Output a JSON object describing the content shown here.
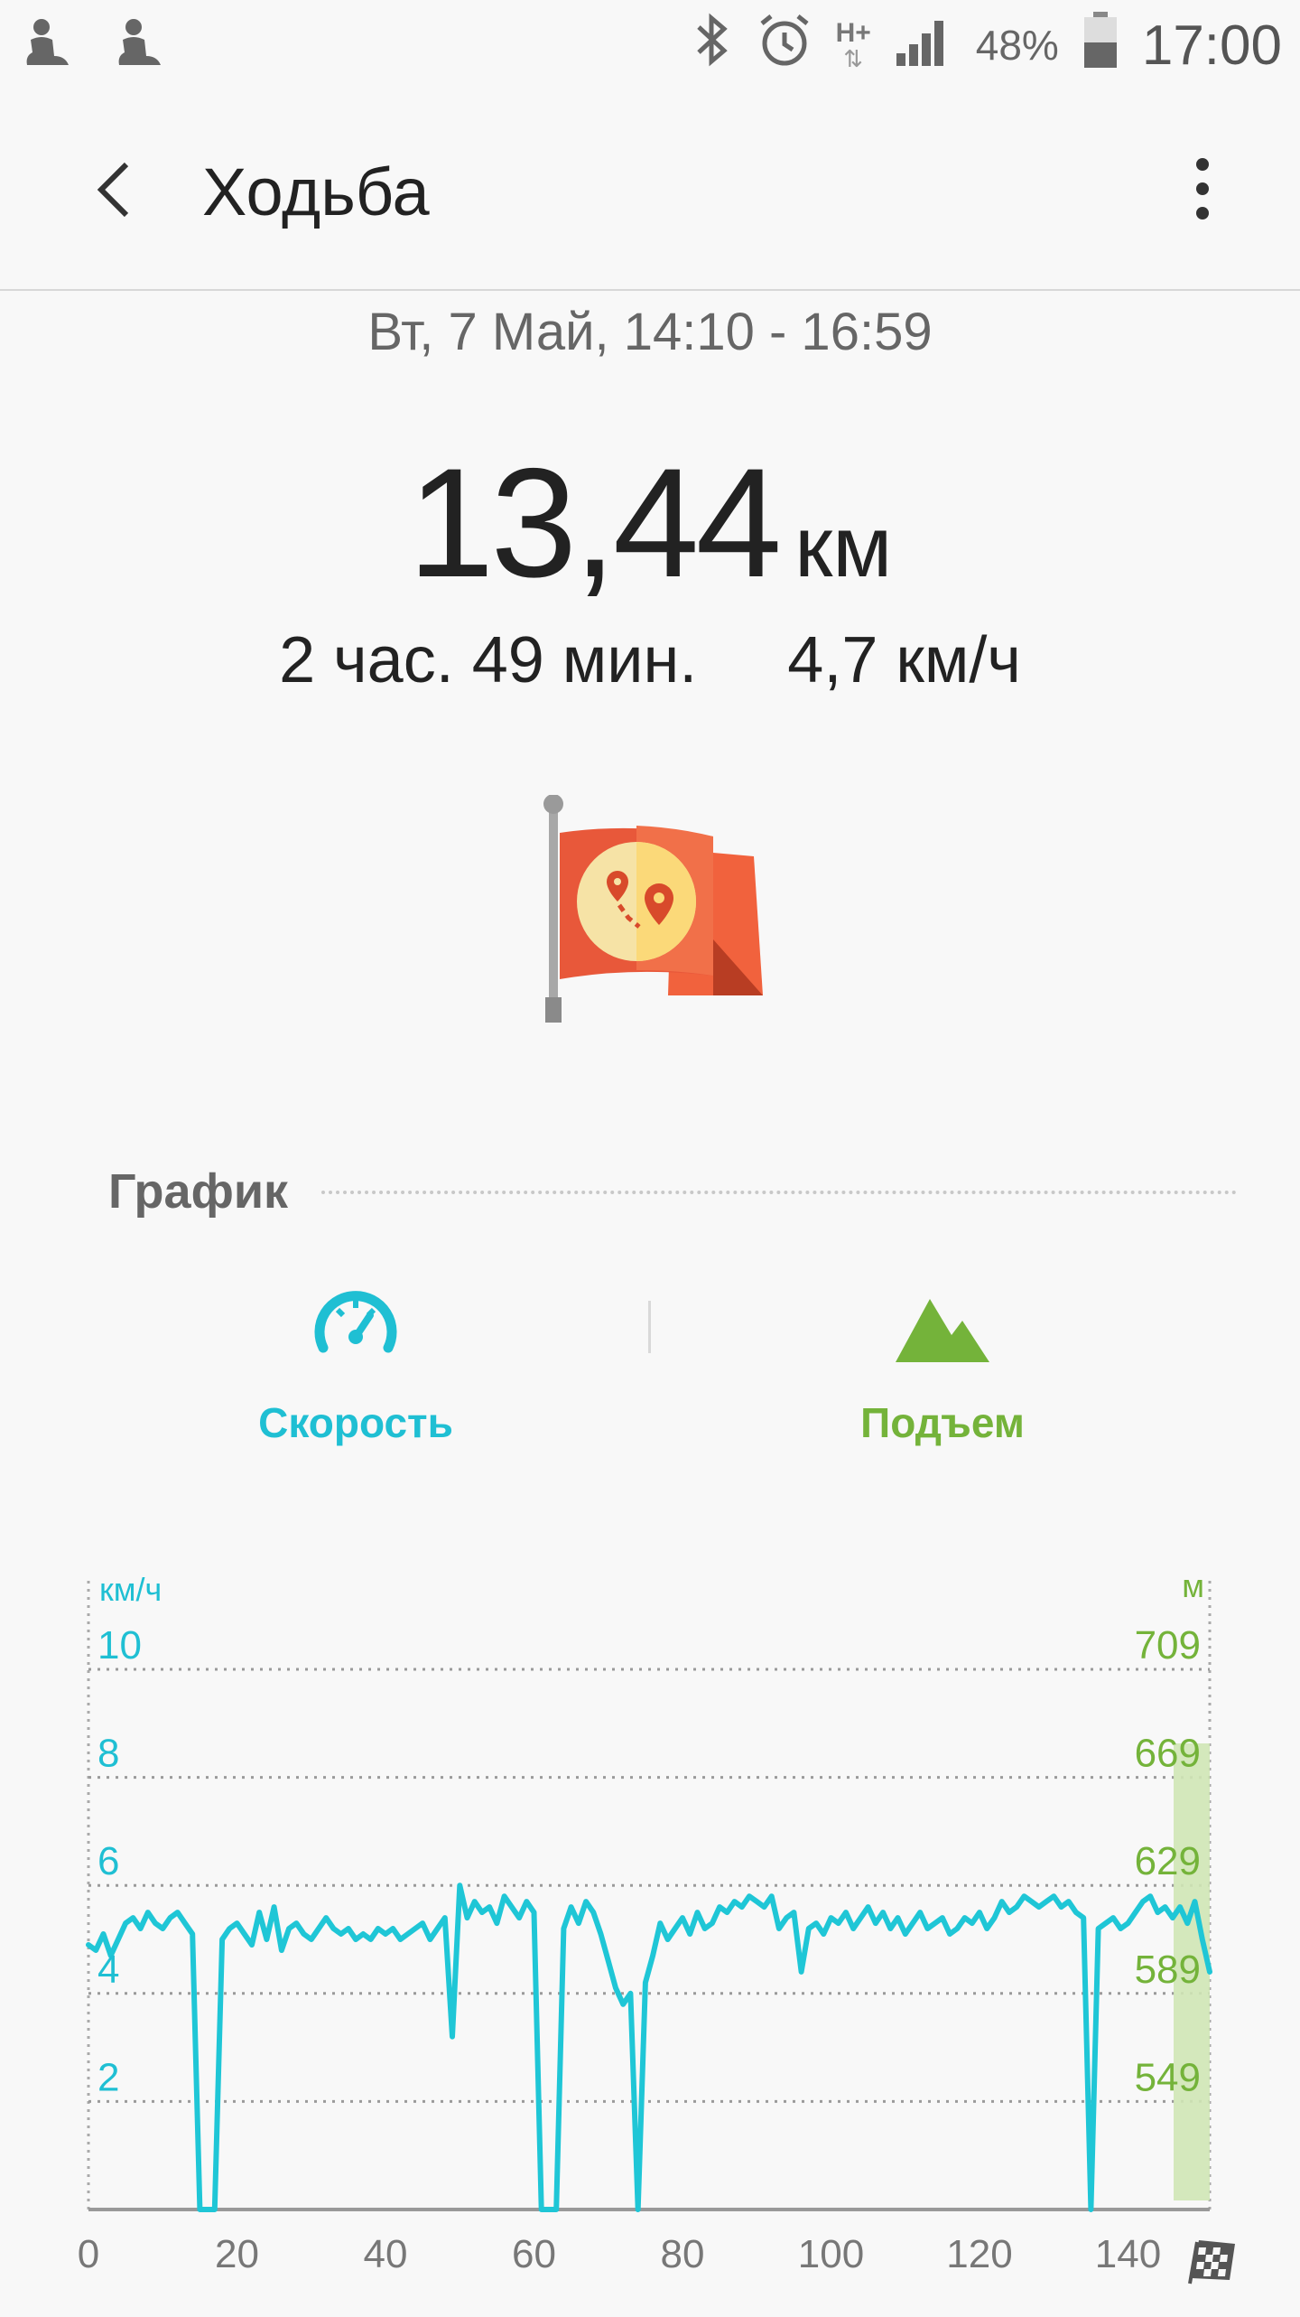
{
  "status_bar": {
    "battery_pct": "48%",
    "time": "17:00",
    "network": "H+",
    "icons": [
      "pedometer-icon",
      "pedometer-icon",
      "bluetooth-icon",
      "alarm-icon",
      "signal-icon",
      "battery-icon"
    ]
  },
  "header": {
    "title": "Ходьба"
  },
  "summary": {
    "date_range": "Вт, 7 Май, 14:10 - 16:59",
    "distance": "13,44",
    "distance_unit": "км",
    "duration": "2 час. 49 мин.",
    "avg_speed": "4,7 км/ч"
  },
  "section": {
    "title": "График"
  },
  "toggles": {
    "speed_label": "Скорость",
    "elevation_label": "Подъем"
  },
  "colors": {
    "speed": "#1fbfd3",
    "elevation": "#74b33a",
    "flag": "#e8583a"
  },
  "chart_data": {
    "type": "line",
    "left_axis_unit": "км/ч",
    "right_axis_unit": "м",
    "y_ticks_left": [
      "10",
      "8",
      "6",
      "4",
      "2"
    ],
    "y_ticks_right": [
      "709",
      "669",
      "629",
      "589",
      "549"
    ],
    "ylim": [
      0,
      10
    ],
    "xlim": [
      0,
      151
    ],
    "x_ticks": [
      "0",
      "20",
      "40",
      "60",
      "80",
      "100",
      "120",
      "140"
    ],
    "grid": true,
    "series": [
      {
        "x": [
          0,
          1,
          2,
          3,
          4,
          5,
          6,
          7,
          8,
          9,
          10,
          11,
          12,
          13,
          14,
          15,
          16,
          17,
          18,
          19,
          20,
          21,
          22,
          23,
          24,
          25,
          26,
          27,
          28,
          29,
          30,
          31,
          32,
          33,
          34,
          35,
          36,
          37,
          38,
          39,
          40,
          41,
          42,
          43,
          44,
          45,
          46,
          47,
          48,
          49,
          50,
          51,
          52,
          53,
          54,
          55,
          56,
          57,
          58,
          59,
          60,
          61,
          62,
          63,
          64,
          65,
          66,
          67,
          68,
          69,
          70,
          71,
          72,
          73,
          74,
          75,
          76,
          77,
          78,
          79,
          80,
          81,
          82,
          83,
          84,
          85,
          86,
          87,
          88,
          89,
          90,
          91,
          92,
          93,
          94,
          95,
          96,
          97,
          98,
          99,
          100,
          101,
          102,
          103,
          104,
          105,
          106,
          107,
          108,
          109,
          110,
          111,
          112,
          113,
          114,
          115,
          116,
          117,
          118,
          119,
          120,
          121,
          122,
          123,
          124,
          125,
          126,
          127,
          128,
          129,
          130,
          131,
          132,
          133,
          134,
          135,
          136,
          137,
          138,
          139,
          140,
          141,
          142,
          143,
          144,
          145,
          146,
          147,
          148,
          149,
          150,
          151
        ],
        "y": [
          4.9,
          4.8,
          5.1,
          4.7,
          5.0,
          5.3,
          5.4,
          5.2,
          5.5,
          5.3,
          5.2,
          5.4,
          5.5,
          5.3,
          5.1,
          0,
          0,
          0,
          5.0,
          5.2,
          5.3,
          5.1,
          4.9,
          5.5,
          5.0,
          5.6,
          4.8,
          5.2,
          5.3,
          5.1,
          5.0,
          5.2,
          5.4,
          5.2,
          5.1,
          5.2,
          5.0,
          5.1,
          5.0,
          5.2,
          5.1,
          5.2,
          5.0,
          5.1,
          5.2,
          5.3,
          5.0,
          5.2,
          5.4,
          3.2,
          6.0,
          5.4,
          5.7,
          5.5,
          5.6,
          5.3,
          5.8,
          5.6,
          5.4,
          5.7,
          5.5,
          0,
          0,
          0,
          5.2,
          5.6,
          5.3,
          5.7,
          5.5,
          5.1,
          4.6,
          4.1,
          3.8,
          4.0,
          0,
          4.2,
          4.7,
          5.3,
          5.0,
          5.2,
          5.4,
          5.1,
          5.5,
          5.2,
          5.3,
          5.6,
          5.5,
          5.7,
          5.6,
          5.8,
          5.7,
          5.6,
          5.8,
          5.2,
          5.4,
          5.5,
          4.4,
          5.2,
          5.3,
          5.1,
          5.4,
          5.3,
          5.5,
          5.2,
          5.4,
          5.6,
          5.3,
          5.5,
          5.2,
          5.4,
          5.1,
          5.3,
          5.5,
          5.2,
          5.3,
          5.4,
          5.1,
          5.2,
          5.4,
          5.3,
          5.5,
          5.2,
          5.4,
          5.7,
          5.5,
          5.6,
          5.8,
          5.7,
          5.6,
          5.7,
          5.8,
          5.6,
          5.7,
          5.5,
          5.4,
          0,
          5.2,
          5.3,
          5.4,
          5.2,
          5.3,
          5.5,
          5.7,
          5.8,
          5.5,
          5.6,
          5.4,
          5.6,
          5.3,
          5.7,
          5.0,
          4.4
        ]
      }
    ]
  }
}
